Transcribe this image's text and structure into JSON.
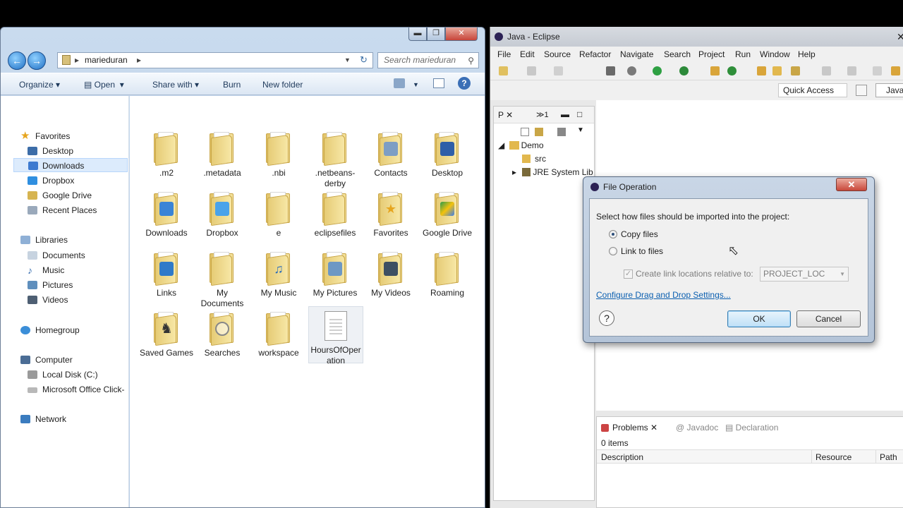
{
  "explorer": {
    "window_controls": {
      "minimize": "▬",
      "maximize": "❐",
      "close": "✕"
    },
    "breadcrumb": "marieduran",
    "search_placeholder": "Search marieduran",
    "toolbar": {
      "organize": "Organize",
      "open": "Open",
      "share_with": "Share with",
      "burn": "Burn",
      "new_folder": "New folder"
    },
    "nav": {
      "favorites": "Favorites",
      "favorites_items": [
        "Desktop",
        "Downloads",
        "Dropbox",
        "Google Drive",
        "Recent Places"
      ],
      "libraries": "Libraries",
      "libraries_items": [
        "Documents",
        "Music",
        "Pictures",
        "Videos"
      ],
      "homegroup": "Homegroup",
      "computer": "Computer",
      "computer_items": [
        "Local Disk (C:)",
        "Microsoft Office Click-"
      ],
      "network": "Network"
    },
    "files": [
      ".m2",
      ".metadata",
      ".nbi",
      ".netbeans-derby",
      "Contacts",
      "Desktop",
      "Downloads",
      "Dropbox",
      "e",
      "eclipsefiles",
      "Favorites",
      "Google Drive",
      "Links",
      "My Documents",
      "My Music",
      "My Pictures",
      "My Videos",
      "Roaming",
      "Saved Games",
      "Searches",
      "workspace",
      "HoursOfOperation"
    ]
  },
  "eclipse": {
    "title": "Java - Eclipse",
    "menu": [
      "File",
      "Edit",
      "Source",
      "Refactor",
      "Navigate",
      "Search",
      "Project",
      "Run",
      "Window",
      "Help"
    ],
    "quick_access": "Quick Access",
    "perspective": "Java",
    "package_tab": "P",
    "second_tab": "1",
    "tree": {
      "project": "Demo",
      "src": "src",
      "jre": "JRE System Lib"
    },
    "problems": {
      "tabs": [
        "Problems",
        "Javadoc",
        "Declaration"
      ],
      "count": "0 items",
      "columns": [
        "Description",
        "Resource",
        "Path"
      ]
    }
  },
  "dialog": {
    "title": "File Operation",
    "prompt": "Select how files should be imported into the project:",
    "option_copy": "Copy files",
    "option_link": "Link to files",
    "checkbox_label": "Create link locations relative to:",
    "select_value": "PROJECT_LOC",
    "link": "Configure Drag and Drop Settings...",
    "ok": "OK",
    "cancel": "Cancel",
    "help": "?",
    "selected_option": "copy"
  },
  "colors": {
    "accent": "#3c7fb1",
    "link": "#0b5fb0",
    "folder": "#e6cc76"
  }
}
